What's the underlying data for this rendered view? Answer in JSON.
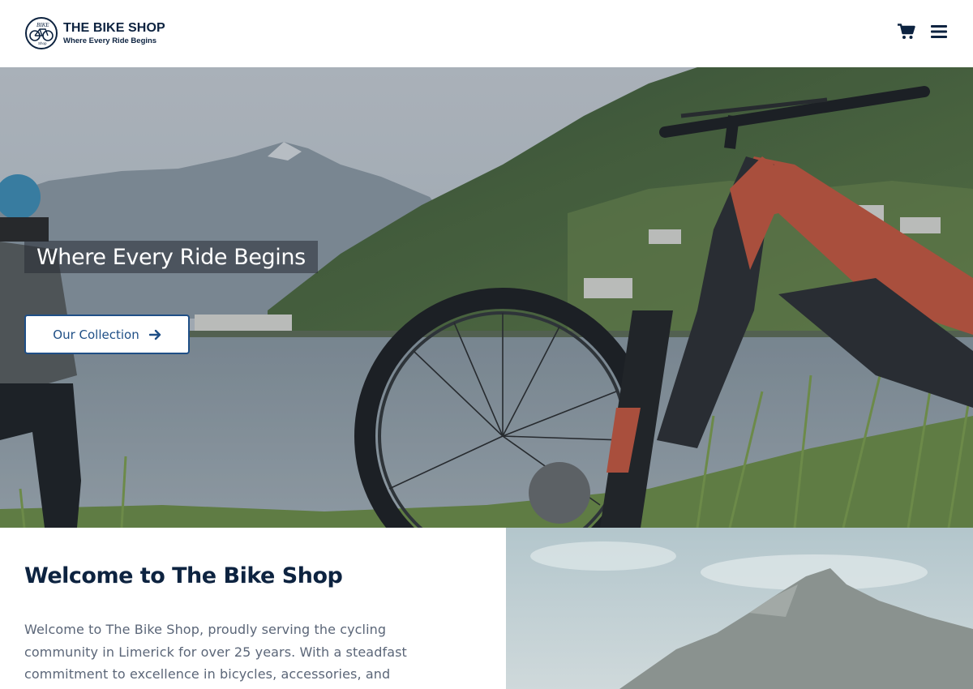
{
  "header": {
    "logo_title": "THE BIKE SHOP",
    "logo_tagline": "Where Every Ride Begins",
    "logo_icon": "bike-shop-logo",
    "cart_icon": "shopping-cart-icon",
    "menu_icon": "hamburger-menu-icon"
  },
  "hero": {
    "title": "Where Every Ride Begins",
    "cta_label": "Our Collection",
    "cta_icon": "arrow-right-icon"
  },
  "welcome": {
    "title": "Welcome to The Bike Shop",
    "body": "Welcome to The Bike Shop, proudly serving the cycling community in Limerick for over 25 years. With a steadfast commitment to excellence in bicycles, accessories, and"
  },
  "colors": {
    "brand_navy": "#0d2340",
    "button_blue": "#1f4f86",
    "body_text": "#5b6678",
    "bike_frame": "#c8583f"
  }
}
